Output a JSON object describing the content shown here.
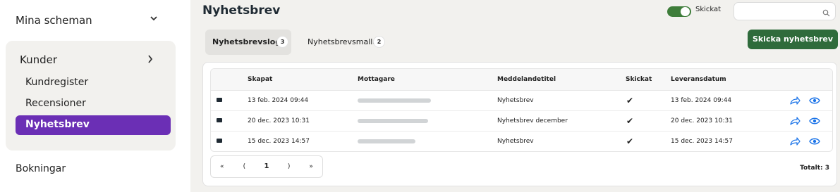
{
  "sidebar": {
    "top_item": "Mina scheman",
    "group": {
      "title": "Kunder",
      "items": [
        {
          "label": "Kundregister"
        },
        {
          "label": "Recensioner"
        },
        {
          "label": "Nyhetsbrev"
        }
      ]
    },
    "bottom_item": "Bokningar"
  },
  "header": {
    "title": "Nyhetsbrev",
    "toggle_label": "Skickat",
    "search_placeholder": ""
  },
  "tabs": [
    {
      "label": "Nyhetsbrevslogg",
      "count": "3"
    },
    {
      "label": "Nyhetsbrevsmallar",
      "count": "2"
    }
  ],
  "send_button": "Skicka nyhetsbrev",
  "table": {
    "columns": [
      "Skapat",
      "Mottagare",
      "Meddelandetitel",
      "Skickat",
      "Leveransdatum"
    ],
    "rows": [
      {
        "created": "13 feb. 2024 09:44",
        "title": "Nyhetsbrev",
        "sent": "✔",
        "delivery": "13 feb. 2024 09:44"
      },
      {
        "created": "20 dec. 2023 10:31",
        "title": "Nyhetsbrev december",
        "sent": "✔",
        "delivery": "20 dec. 2023 10:31"
      },
      {
        "created": "15 dec. 2023 14:57",
        "title": "Nyhetsbrev",
        "sent": "✔",
        "delivery": "15 dec. 2023 14:57"
      }
    ]
  },
  "pagination": {
    "first": "«",
    "prev": "(",
    "page": "1",
    "next": ")",
    "last": "»"
  },
  "total": "Totalt: 3",
  "colors": {
    "accent_purple": "#6b2fb5",
    "accent_green": "#2f6b3b",
    "icon_blue": "#1a73e8"
  },
  "icons": [
    "chevron-down-icon",
    "chevron-right-icon",
    "search-icon",
    "mail-icon",
    "check-icon",
    "forward-icon",
    "eye-icon"
  ]
}
